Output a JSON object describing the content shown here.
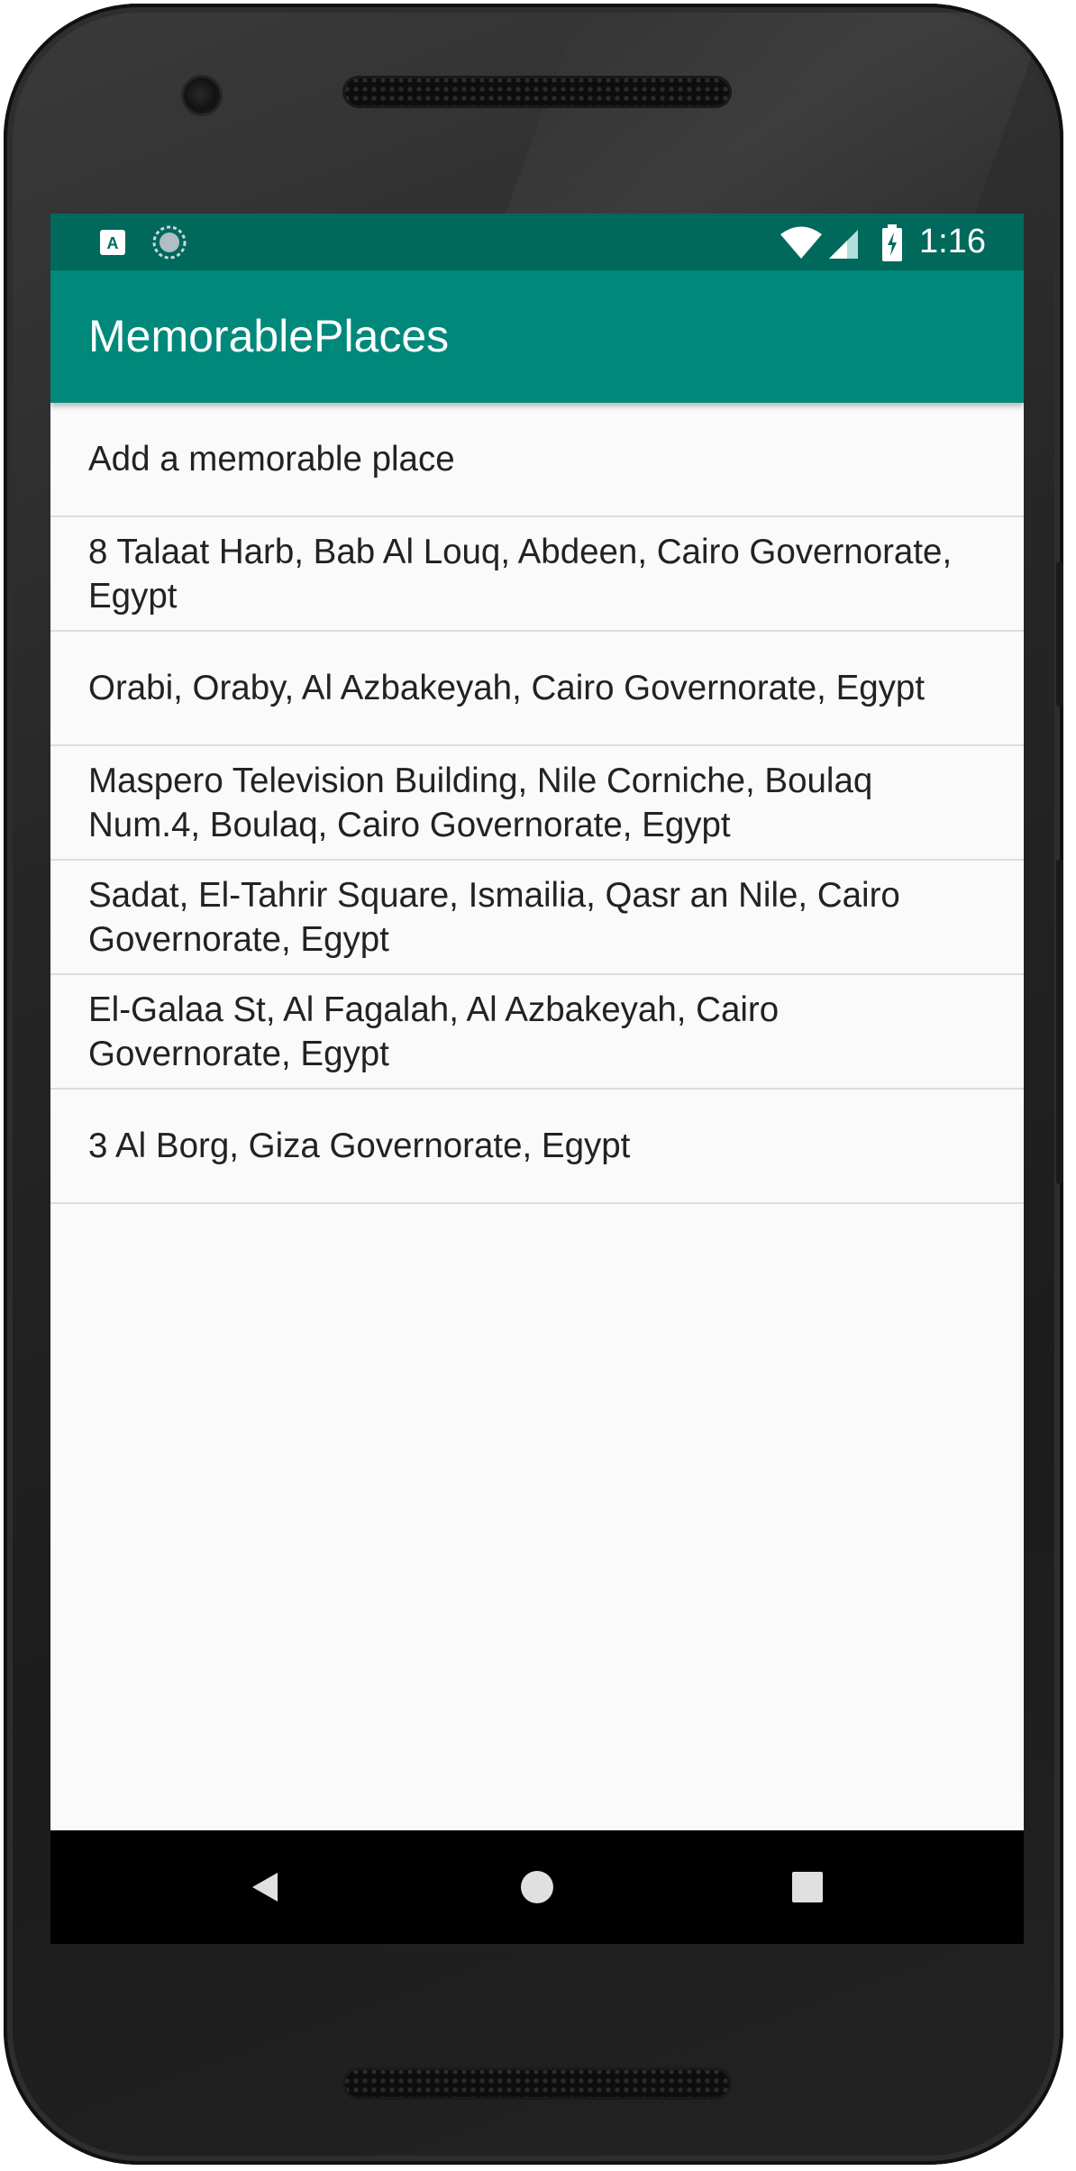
{
  "status_bar": {
    "time": "1:16",
    "left_icons": [
      "keyboard-a-icon",
      "sync-icon"
    ],
    "right_icons": [
      "wifi-icon",
      "signal-icon",
      "battery-charging-icon"
    ]
  },
  "app_bar": {
    "title": "MemorablePlaces"
  },
  "places": [
    "Add a memorable place",
    "8 Talaat Harb, Bab Al Louq, Abdeen, Cairo Governorate, Egypt",
    "Orabi, Oraby, Al Azbakeyah, Cairo Governorate, Egypt",
    "Maspero Television Building, Nile Corniche, Boulaq Num.4, Boulaq, Cairo Governorate, Egypt",
    "Sadat, El-Tahrir Square, Ismailia, Qasr an Nile, Cairo Governorate, Egypt",
    "El-Galaa St, Al Fagalah, Al Azbakeyah, Cairo Governorate, Egypt",
    "3 Al Borg, Giza Governorate, Egypt"
  ],
  "nav_bar": {
    "buttons": [
      "back-icon",
      "home-icon",
      "recents-icon"
    ]
  },
  "colors": {
    "status_bar": "#00695c",
    "app_bar": "#00897b",
    "background": "#fafafa",
    "divider": "#dcdcdc"
  }
}
